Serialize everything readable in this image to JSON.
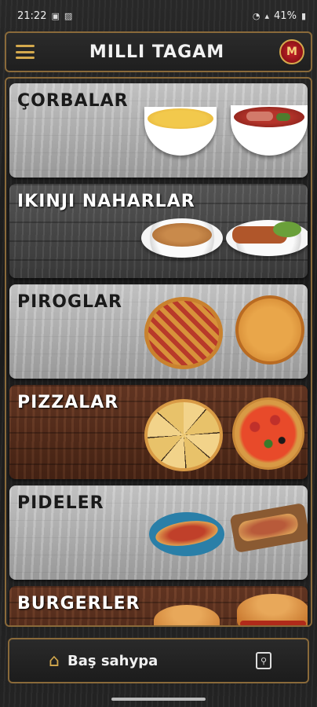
{
  "status_bar": {
    "time": "21:22",
    "battery": "41%"
  },
  "app_bar": {
    "title": "MILLI TAGAM",
    "logo_text": "M"
  },
  "categories": [
    {
      "label": "ÇORBALAR",
      "theme": "light",
      "food": "soup"
    },
    {
      "label": "IKINJI NAHARLAR",
      "theme": "dark",
      "food": "mains"
    },
    {
      "label": "PIROGLAR",
      "theme": "light",
      "food": "pies"
    },
    {
      "label": "PIZZALAR",
      "theme": "brown",
      "food": "pizza"
    },
    {
      "label": "PIDELER",
      "theme": "light",
      "food": "pide"
    },
    {
      "label": "BURGERLER",
      "theme": "brown",
      "food": "burger"
    }
  ],
  "bottom_nav": {
    "home_label": "Baş sahypa"
  },
  "colors": {
    "accent_gold": "#d4a94d",
    "frame_border": "#8a6a3a",
    "logo_red": "#c9242c"
  }
}
